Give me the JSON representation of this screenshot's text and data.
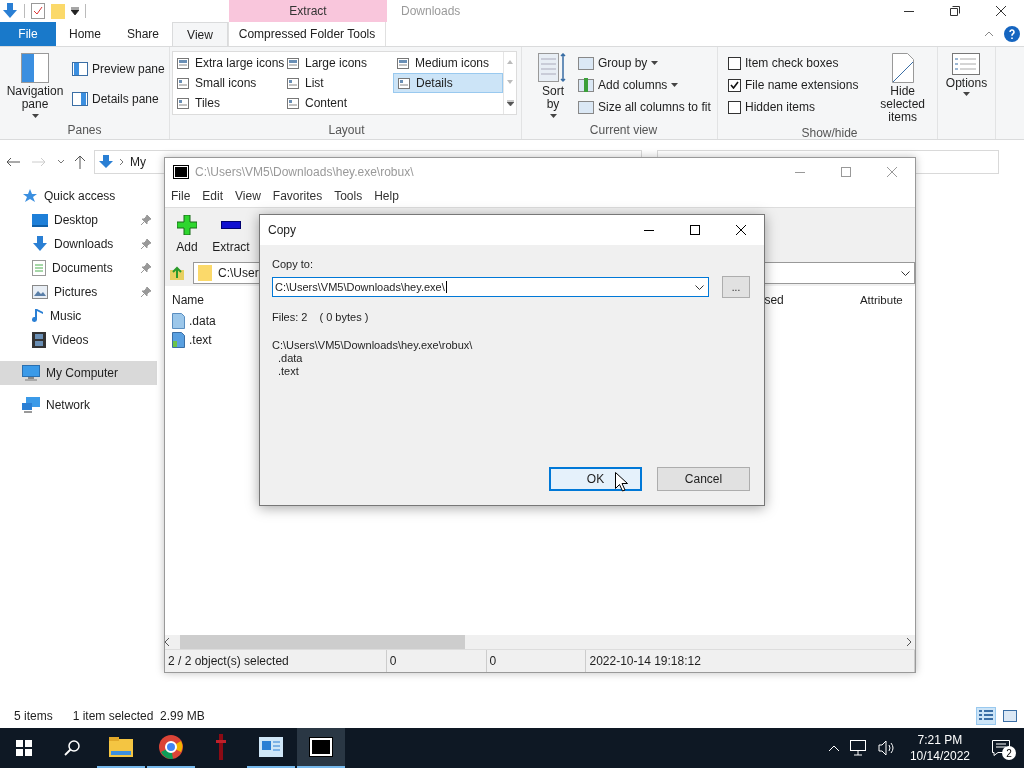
{
  "explorer": {
    "title": "Downloads",
    "contextual_header": "Extract",
    "tabs": [
      {
        "label": "File",
        "kind": "file",
        "selected": false
      },
      {
        "label": "Home",
        "kind": "tab",
        "selected": false
      },
      {
        "label": "Share",
        "kind": "tab",
        "selected": false
      },
      {
        "label": "View",
        "kind": "tab",
        "selected": true
      },
      {
        "label": "Compressed Folder Tools",
        "kind": "contextual",
        "selected": false
      }
    ],
    "ribbon": {
      "panes": {
        "title": "Panes",
        "large": "Navigation pane",
        "small": [
          "Preview pane",
          "Details pane"
        ]
      },
      "layout": {
        "title": "Layout",
        "options": [
          {
            "label": "Extra large icons",
            "selected": false
          },
          {
            "label": "Small icons",
            "selected": false
          },
          {
            "label": "Tiles",
            "selected": false
          },
          {
            "label": "Large icons",
            "selected": false
          },
          {
            "label": "List",
            "selected": false
          },
          {
            "label": "Content",
            "selected": false
          },
          {
            "label": "Medium icons",
            "selected": false
          },
          {
            "label": "Details",
            "selected": true
          }
        ]
      },
      "current_view": {
        "title": "Current view",
        "sort": "Sort by",
        "items": [
          {
            "label": "Group by",
            "dropdown": true
          },
          {
            "label": "Add columns",
            "dropdown": true
          },
          {
            "label": "Size all columns to fit",
            "dropdown": false
          }
        ]
      },
      "show_hide": {
        "title": "Show/hide",
        "checkboxes": [
          {
            "label": "Item check boxes",
            "checked": false
          },
          {
            "label": "File name extensions",
            "checked": true
          },
          {
            "label": "Hidden items",
            "checked": false
          }
        ],
        "hide_selected": "Hide selected items"
      },
      "options": "Options"
    },
    "address": "My",
    "nav_items": [
      {
        "label": "Quick access",
        "kind": "star",
        "pinned": false,
        "selected": false
      },
      {
        "label": "Desktop",
        "kind": "desktop",
        "pinned": true,
        "selected": false
      },
      {
        "label": "Downloads",
        "kind": "download",
        "pinned": true,
        "selected": false
      },
      {
        "label": "Documents",
        "kind": "document",
        "pinned": true,
        "selected": false
      },
      {
        "label": "Pictures",
        "kind": "picture",
        "pinned": true,
        "selected": false
      },
      {
        "label": "Music",
        "kind": "music",
        "pinned": false,
        "selected": false
      },
      {
        "label": "Videos",
        "kind": "video",
        "pinned": false,
        "selected": false
      },
      {
        "label": "My Computer",
        "kind": "computer",
        "pinned": false,
        "selected": true
      },
      {
        "label": "Network",
        "kind": "network",
        "pinned": false,
        "selected": false
      }
    ],
    "status": {
      "count": "5 items",
      "selection": "1 item selected  2.99 MB"
    },
    "view_buttons": [
      {
        "kind": "details",
        "selected": true
      },
      {
        "kind": "thumbnails",
        "selected": false
      }
    ]
  },
  "sevenzip": {
    "title": "C:\\Users\\VM5\\Downloads\\hey.exe\\robux\\",
    "menu": [
      "File",
      "Edit",
      "View",
      "Favorites",
      "Tools",
      "Help"
    ],
    "toolbar": [
      {
        "label": "Add",
        "kind": "add"
      },
      {
        "label": "Extract",
        "kind": "extract"
      }
    ],
    "path": "C:\\User",
    "columns": [
      "Name",
      "sed",
      "Attribute"
    ],
    "rows": [
      {
        "name": ".data",
        "kind": "blank"
      },
      {
        "name": ".text",
        "kind": "colored"
      }
    ],
    "status": [
      "2 / 2 object(s) selected",
      "0",
      "0",
      "2022-10-14 19:18:12"
    ]
  },
  "dialog": {
    "title": "Copy",
    "copy_to_label": "Copy to:",
    "destination": "C:\\Users\\VM5\\Downloads\\hey.exe\\",
    "browse": "...",
    "files_count": "Files: 2",
    "size": "( 0 bytes )",
    "source_path": "C:\\Users\\VM5\\Downloads\\hey.exe\\robux\\",
    "source_files": [
      ".data",
      ".text"
    ],
    "buttons": [
      {
        "label": "OK",
        "focused": true
      },
      {
        "label": "Cancel",
        "focused": false
      }
    ]
  },
  "taskbar": {
    "apps": [
      {
        "kind": "folder",
        "running": true,
        "active": false
      },
      {
        "kind": "browser",
        "running": true,
        "active": false
      },
      {
        "kind": "red",
        "running": false,
        "active": false
      },
      {
        "kind": "blue",
        "running": true,
        "active": false
      },
      {
        "kind": "sevenzip",
        "running": true,
        "active": true
      }
    ],
    "time": "7:21 PM",
    "date": "10/14/2022",
    "notifications": "2"
  }
}
